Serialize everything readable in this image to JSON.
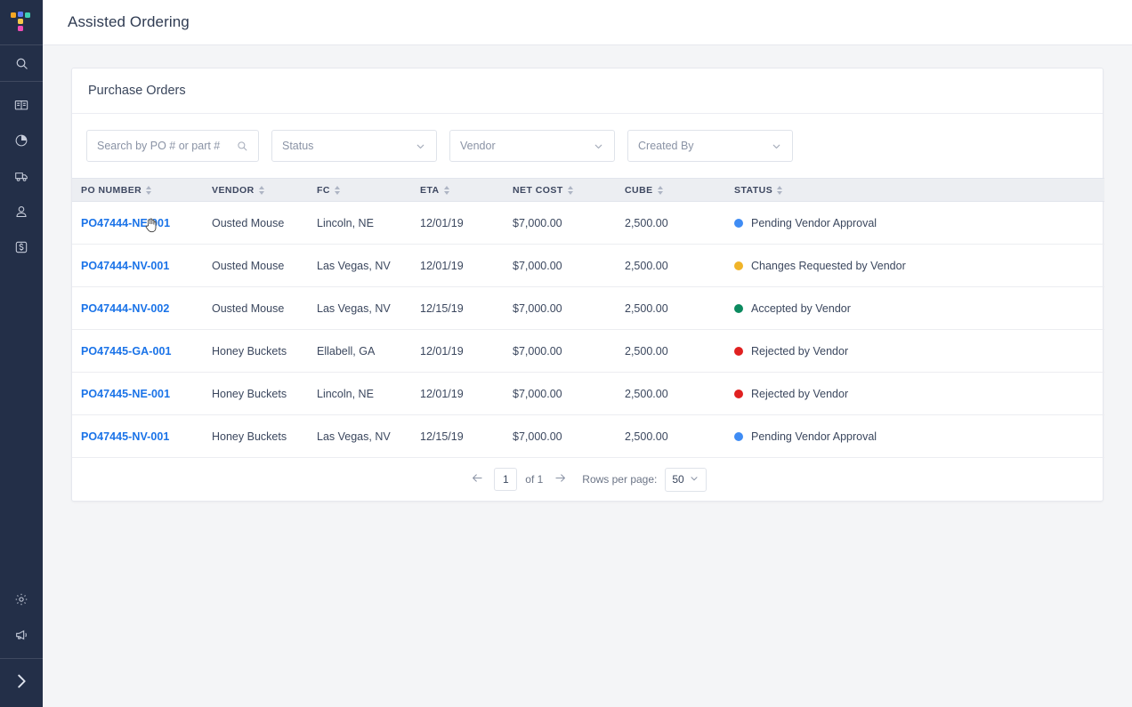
{
  "app": {
    "logo_name": "toast-logo",
    "logo_colors": [
      "#f5a623",
      "#5b7cf7",
      "#3ecfb2",
      "#f7c948",
      "#ef4db6"
    ],
    "title": "Assisted Ordering"
  },
  "sidebar": {
    "search_icon": "search-icon",
    "items": [
      {
        "icon": "book-icon",
        "name": "catalog"
      },
      {
        "icon": "pie-chart-icon",
        "name": "reports"
      },
      {
        "icon": "truck-icon",
        "name": "shipments"
      },
      {
        "icon": "user-icon",
        "name": "vendors"
      },
      {
        "icon": "dollar-box-icon",
        "name": "finance"
      }
    ],
    "bottom_items": [
      {
        "icon": "gear-icon",
        "name": "settings"
      },
      {
        "icon": "megaphone-icon",
        "name": "announcements"
      }
    ],
    "expand_icon": "chevron-right-icon"
  },
  "card": {
    "title": "Purchase Orders"
  },
  "filters": {
    "search": {
      "placeholder": "Search by PO # or part #",
      "value": "",
      "icon": "search-icon"
    },
    "status": {
      "label": "Status",
      "value": ""
    },
    "vendor": {
      "label": "Vendor",
      "value": ""
    },
    "created_by": {
      "label": "Created By",
      "value": ""
    }
  },
  "table": {
    "columns": [
      {
        "key": "po",
        "label": "PO NUMBER",
        "sortable": true
      },
      {
        "key": "vendor",
        "label": "VENDOR",
        "sortable": true
      },
      {
        "key": "fc",
        "label": "FC",
        "sortable": true
      },
      {
        "key": "eta",
        "label": "ETA",
        "sortable": true
      },
      {
        "key": "cost",
        "label": "NET COST",
        "sortable": true
      },
      {
        "key": "cube",
        "label": "CUBE",
        "sortable": true
      },
      {
        "key": "status",
        "label": "STATUS",
        "sortable": true
      }
    ],
    "rows": [
      {
        "po": "PO47444-NE-001",
        "vendor": "Ousted Mouse",
        "fc": "Lincoln, NE",
        "eta": "12/01/19",
        "cost": "$7,000.00",
        "cube": "2,500.00",
        "status": "Pending Vendor Approval",
        "status_color": "#3f8cf4"
      },
      {
        "po": "PO47444-NV-001",
        "vendor": "Ousted Mouse",
        "fc": "Las Vegas, NV",
        "eta": "12/01/19",
        "cost": "$7,000.00",
        "cube": "2,500.00",
        "status": "Changes Requested by Vendor",
        "status_color": "#f0b429"
      },
      {
        "po": "PO47444-NV-002",
        "vendor": "Ousted Mouse",
        "fc": "Las Vegas, NV",
        "eta": "12/15/19",
        "cost": "$7,000.00",
        "cube": "2,500.00",
        "status": "Accepted by Vendor",
        "status_color": "#0c8a5f"
      },
      {
        "po": "PO47445-GA-001",
        "vendor": "Honey Buckets",
        "fc": "Ellabell, GA",
        "eta": "12/01/19",
        "cost": "$7,000.00",
        "cube": "2,500.00",
        "status": "Rejected by Vendor",
        "status_color": "#e02020"
      },
      {
        "po": "PO47445-NE-001",
        "vendor": "Honey Buckets",
        "fc": "Lincoln, NE",
        "eta": "12/01/19",
        "cost": "$7,000.00",
        "cube": "2,500.00",
        "status": "Rejected by Vendor",
        "status_color": "#e02020"
      },
      {
        "po": "PO47445-NV-001",
        "vendor": "Honey Buckets",
        "fc": "Las Vegas, NV",
        "eta": "12/15/19",
        "cost": "$7,000.00",
        "cube": "2,500.00",
        "status": "Pending Vendor Approval",
        "status_color": "#3f8cf4"
      }
    ]
  },
  "pagination": {
    "prev_icon": "arrow-left-icon",
    "next_icon": "arrow-right-icon",
    "page": "1",
    "of_label": "of 1",
    "rows_label": "Rows per page:",
    "rows_value": "50"
  },
  "colors": {
    "accent_link": "#1a73e8",
    "sidebar_bg": "#232f48",
    "page_bg": "#f4f5f7",
    "table_header_bg": "#eceef2"
  }
}
